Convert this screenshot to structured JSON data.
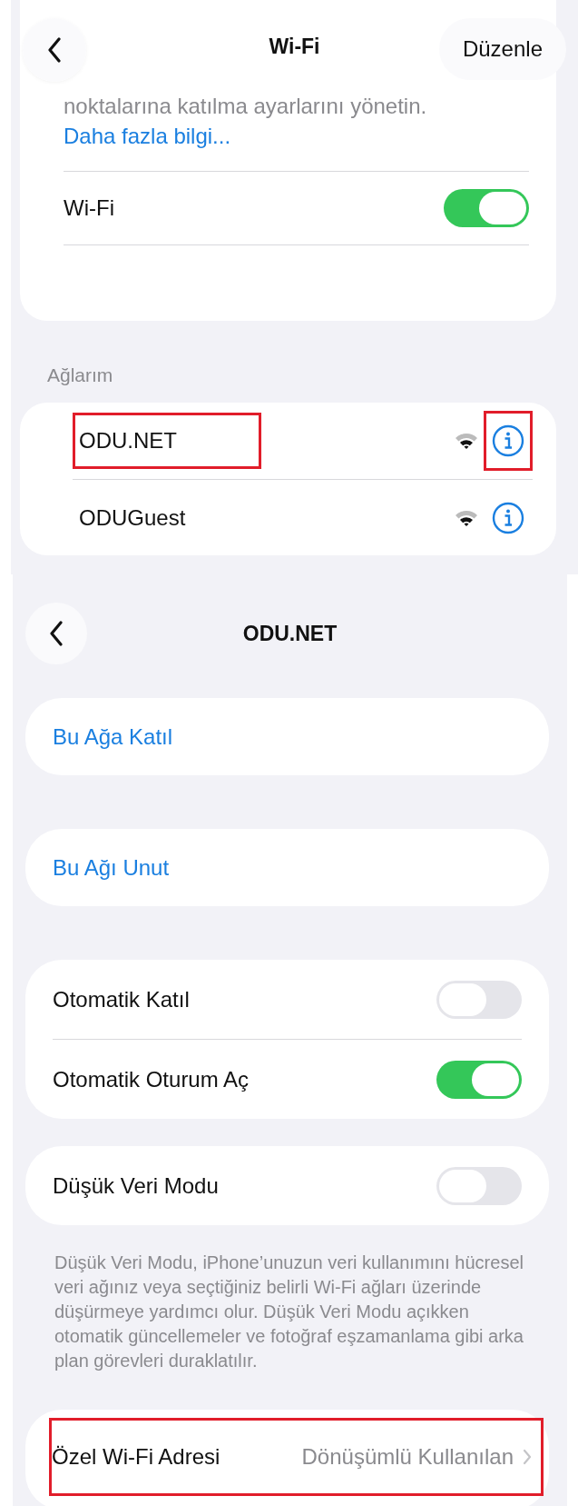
{
  "top_screen": {
    "nav": {
      "title": "Wi-Fi",
      "edit_button": "Düzenle"
    },
    "intro": {
      "text": "noktalarına katılma ayarlarını yönetin.",
      "link": "Daha fazla bilgi..."
    },
    "wifi_toggle": {
      "label": "Wi-Fi",
      "on": true
    },
    "networks_header": "Ağlarım",
    "networks": [
      {
        "name": "ODU.NET",
        "highlighted": true,
        "info_highlighted": true
      },
      {
        "name": "ODUGuest",
        "highlighted": false,
        "info_highlighted": false
      }
    ]
  },
  "detail_screen": {
    "nav": {
      "title": "ODU.NET"
    },
    "actions": [
      "Bu Ağa Katıl",
      "Bu Ağı Unut"
    ],
    "auto_toggles": [
      {
        "label": "Otomatik Katıl",
        "on": false
      },
      {
        "label": "Otomatik Oturum Aç",
        "on": true
      }
    ],
    "low_data": {
      "label": "Düşük Veri Modu",
      "on": false,
      "footer": "Düşük Veri Modu, iPhone’unuzun veri kullanımını hücresel veri ağınız veya seçtiğiniz belirli Wi-Fi ağları üzerinde düşürmeye yardımcı olur. Düşük Veri Modu açıkken otomatik güncellemeler ve fotoğraf eşzamanlama gibi arka plan görevleri duraklatılır."
    },
    "private_address": {
      "label": "Özel Wi-Fi Adresi",
      "value": "Dönüşümlü Kullanılan",
      "highlighted": true
    }
  }
}
